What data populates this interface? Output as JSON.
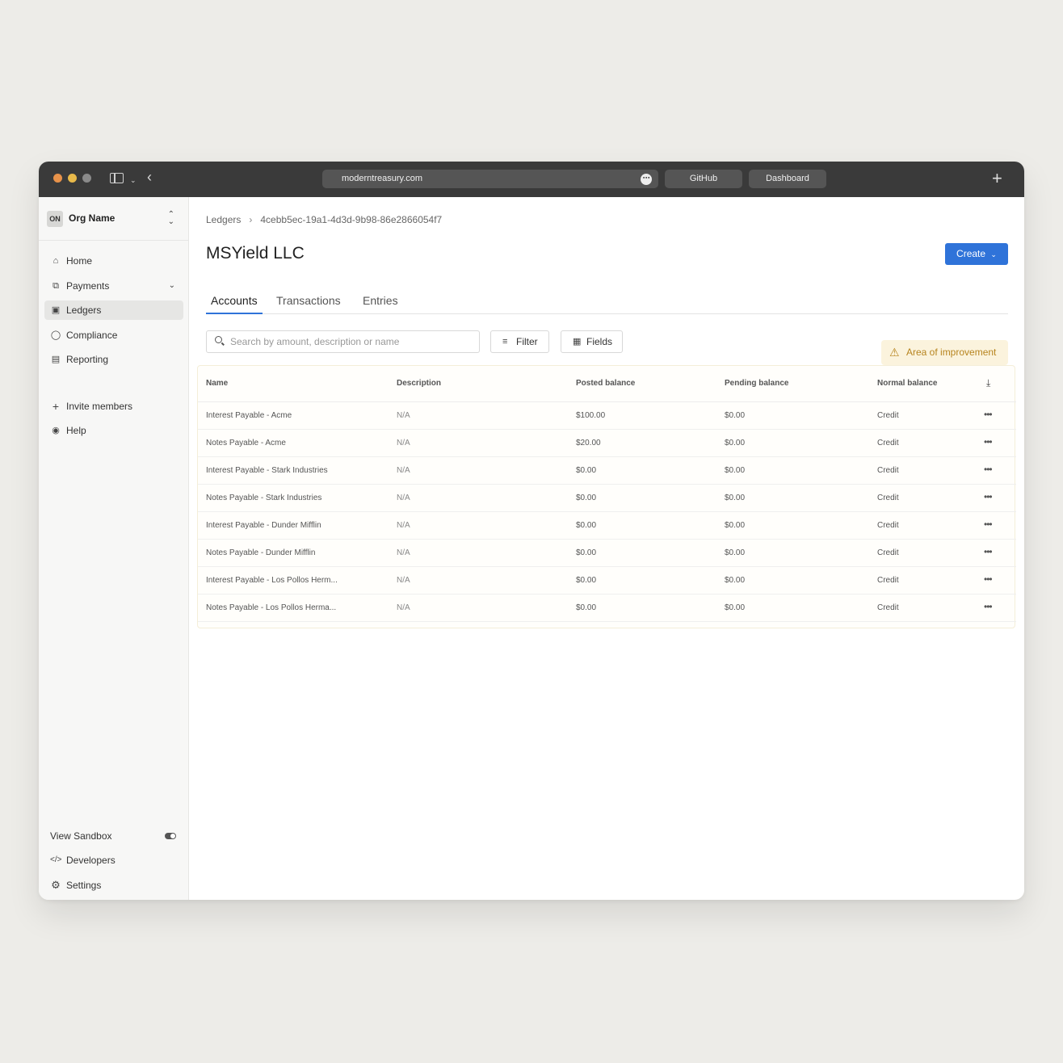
{
  "browser": {
    "url": "moderntreasury.com",
    "tabs": [
      "GitHub",
      "Dashboard"
    ]
  },
  "sidebar": {
    "org_badge": "ON",
    "org_name": "Org Name",
    "nav": [
      {
        "label": "Home",
        "icon": "home-icon"
      },
      {
        "label": "Payments",
        "icon": "payments-icon"
      },
      {
        "label": "Ledgers",
        "icon": "book-icon",
        "active": true
      },
      {
        "label": "Compliance",
        "icon": "shield-icon"
      },
      {
        "label": "Reporting",
        "icon": "report-icon"
      }
    ],
    "secondary": [
      {
        "label": "Invite members",
        "icon": "plus-icon"
      },
      {
        "label": "Help",
        "icon": "help-icon"
      }
    ],
    "footer": [
      {
        "label": "View Sandbox",
        "icon": "toggle-icon"
      },
      {
        "label": "Developers",
        "icon": "code-icon"
      },
      {
        "label": "Settings",
        "icon": "gear-icon"
      }
    ]
  },
  "main": {
    "breadcrumb": [
      "Ledgers",
      "4cebb5ec-19a1-4d3d-9b98-86e2866054f7"
    ],
    "title": "MSYield LLC",
    "create_label": "Create",
    "tabs": [
      "Accounts",
      "Transactions",
      "Entries"
    ],
    "search_placeholder": "Search by amount, description or name",
    "filter_label": "Filter",
    "fields_label": "Fields",
    "improvement_label": "Area of improvement",
    "accent_color": "#2f73d9",
    "warning_color": "#b7841e"
  },
  "table": {
    "columns": [
      "Name",
      "Description",
      "Posted balance",
      "Pending balance",
      "Normal balance"
    ],
    "rows": [
      {
        "name": "Interest Payable - Acme",
        "description": "N/A",
        "posted": "$100.00",
        "pending": "$0.00",
        "normal": "Credit"
      },
      {
        "name": "Notes Payable - Acme",
        "description": "N/A",
        "posted": "$20.00",
        "pending": "$0.00",
        "normal": "Credit"
      },
      {
        "name": "Interest Payable - Stark Industries",
        "description": "N/A",
        "posted": "$0.00",
        "pending": "$0.00",
        "normal": "Credit"
      },
      {
        "name": "Notes Payable - Stark Industries",
        "description": "N/A",
        "posted": "$0.00",
        "pending": "$0.00",
        "normal": "Credit"
      },
      {
        "name": "Interest Payable - Dunder Mifflin",
        "description": "N/A",
        "posted": "$0.00",
        "pending": "$0.00",
        "normal": "Credit"
      },
      {
        "name": "Notes Payable - Dunder Mifflin",
        "description": "N/A",
        "posted": "$0.00",
        "pending": "$0.00",
        "normal": "Credit"
      },
      {
        "name": "Interest Payable - Los Pollos Herm...",
        "description": "N/A",
        "posted": "$0.00",
        "pending": "$0.00",
        "normal": "Credit"
      },
      {
        "name": "Notes Payable - Los Pollos Herma...",
        "description": "N/A",
        "posted": "$0.00",
        "pending": "$0.00",
        "normal": "Credit"
      }
    ]
  }
}
